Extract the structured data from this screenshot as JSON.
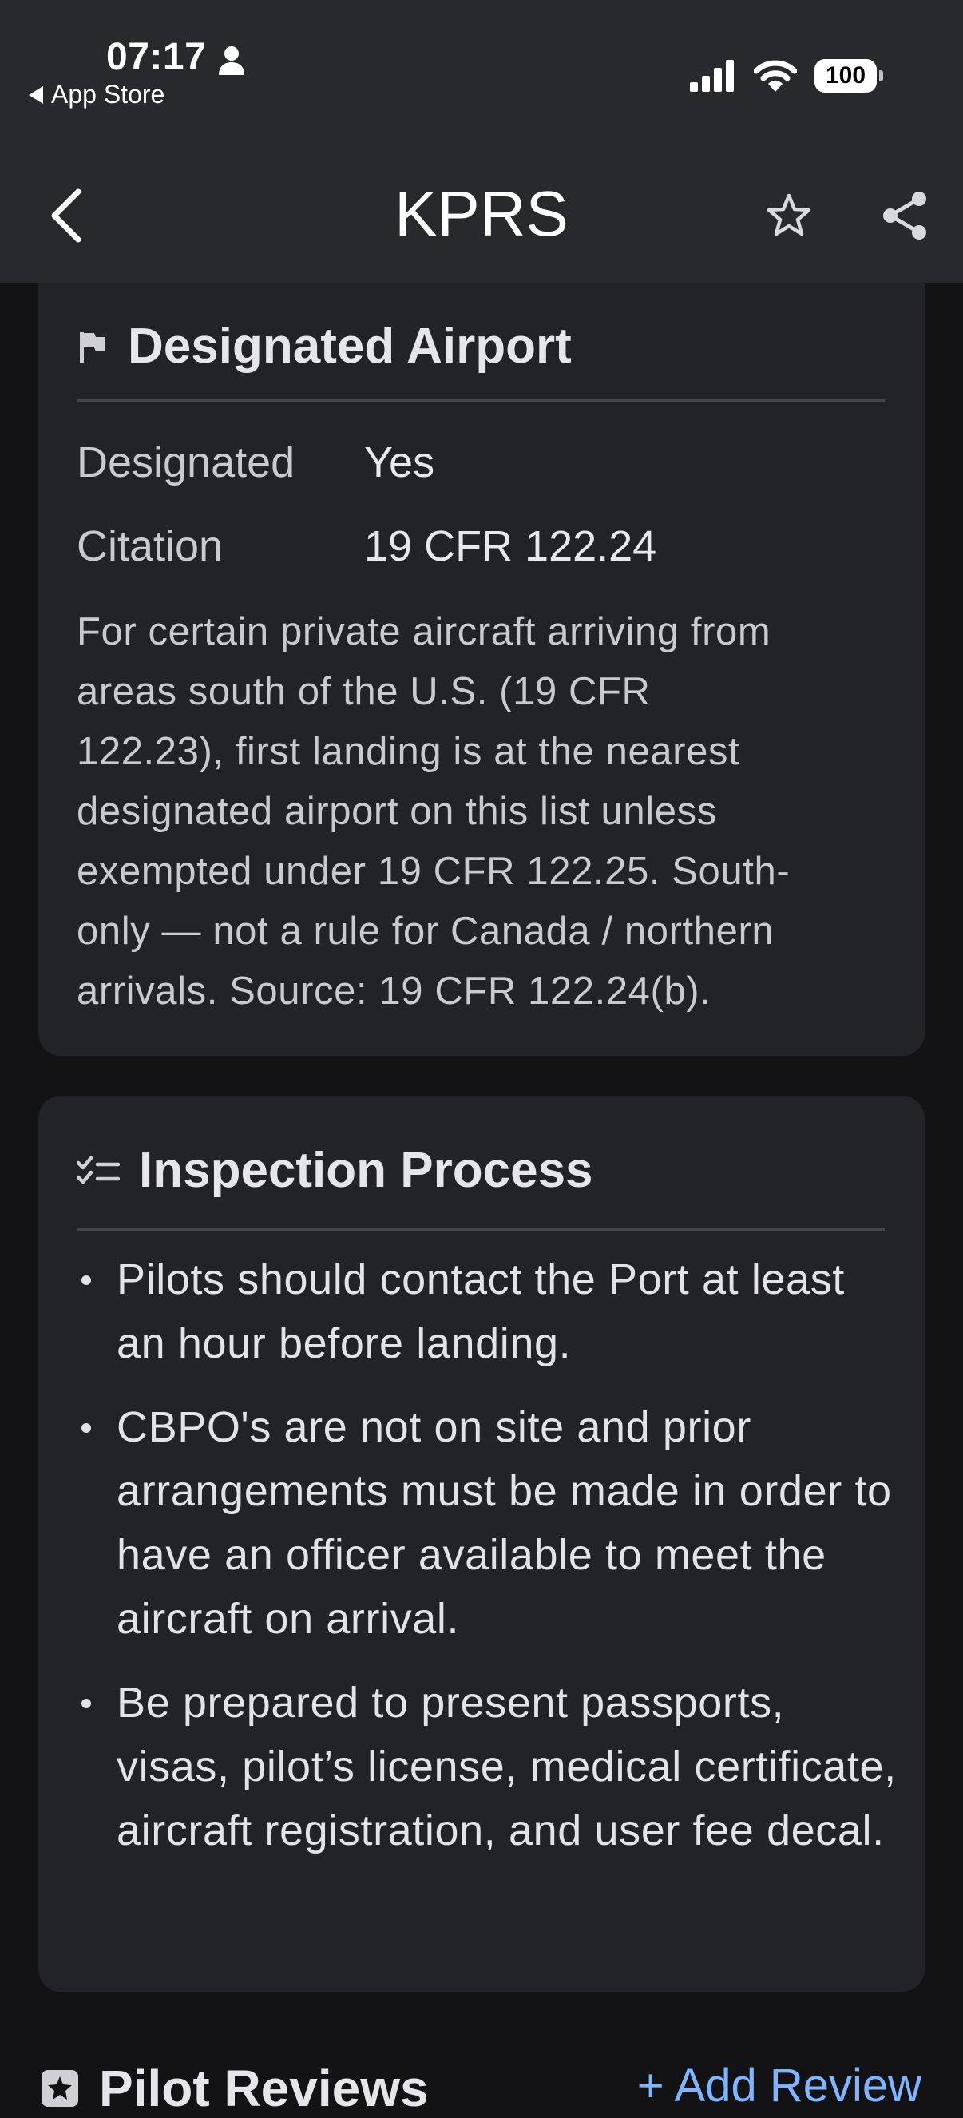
{
  "status_bar": {
    "time": "07:17",
    "back_app": "App Store",
    "battery": "100"
  },
  "nav": {
    "title": "KPRS"
  },
  "designated_card": {
    "title": "Designated Airport",
    "rows": [
      {
        "key": "Designated",
        "value": "Yes"
      },
      {
        "key": "Citation",
        "value": "19 CFR 122.24"
      }
    ],
    "note_lines": [
      "For certain private aircraft arriving from",
      "areas south of the U.S. (19 CFR",
      "122.23), first landing is at the nearest",
      "designated airport on this list unless",
      "exempted under 19 CFR 122.25. South-",
      "only — not a rule for Canada / northern",
      "arrivals. Source: 19 CFR 122.24(b)."
    ]
  },
  "inspection_card": {
    "title": "Inspection Process",
    "items": [
      "Pilots should contact the Port at least an hour before landing.",
      "CBPO's are not on site and prior arrangements must be made in order to have an officer available to meet the aircraft on arrival.",
      "Be prepared to present passports, visas, pilot’s license, medical certificate, aircraft registration, and user fee decal."
    ]
  },
  "reviews": {
    "title": "Pilot Reviews",
    "add_label": "+ Add Review"
  },
  "colors": {
    "topbar": "#27292d",
    "background": "#131316",
    "card": "#222327",
    "accent": "#7fb5ff"
  }
}
